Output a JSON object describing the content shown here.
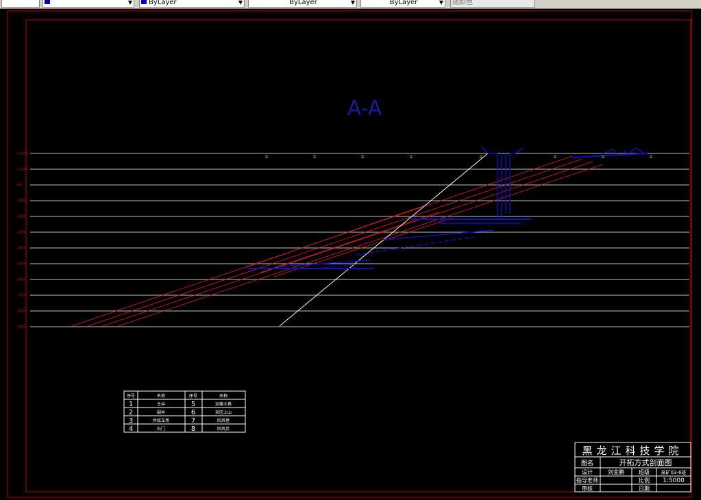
{
  "toolbar": {
    "layer_value": "ByLayer",
    "linetype_value": "ByLayer",
    "lineweight_value": "ByLayer",
    "plotstyle_value": "随颜色"
  },
  "drawing": {
    "section_title": "A-A",
    "elevations": [
      "+150",
      "+100",
      "±0",
      "-100",
      "-200",
      "-300",
      "-400",
      "-500",
      "-600",
      "-700",
      "-800",
      "-900"
    ]
  },
  "legend": {
    "headers": [
      "序号",
      "名称",
      "序号",
      "名称"
    ],
    "rows": [
      {
        "n1": "1",
        "name1": "主井",
        "n2": "5",
        "name2": "运输大巷"
      },
      {
        "n1": "2",
        "name1": "副井",
        "n2": "6",
        "name2": "采区上山"
      },
      {
        "n1": "3",
        "name1": "井底车场",
        "n2": "7",
        "name2": "回风巷"
      },
      {
        "n1": "4",
        "name1": "石门",
        "n2": "8",
        "name2": "回风井"
      }
    ]
  },
  "title_block": {
    "school": "黑龙江科技学院",
    "name_label": "图名",
    "drawing_name": "开拓方式剖面图",
    "design_label": "设计",
    "designer": "刘金鹏",
    "class_label": "班级",
    "class_value": "采矿03-6班",
    "advisor_label": "指导老师",
    "scale_label": "比例",
    "scale_value": "1:5000",
    "review_label": "审核",
    "date_label": "日期"
  },
  "colors": {
    "background": "#000000",
    "frame": "#c00000",
    "seam": "#e02020",
    "level_line": "#ffffff",
    "workings": "#1010c0",
    "title": "#1a1aa0",
    "marker": "#e0e000"
  }
}
